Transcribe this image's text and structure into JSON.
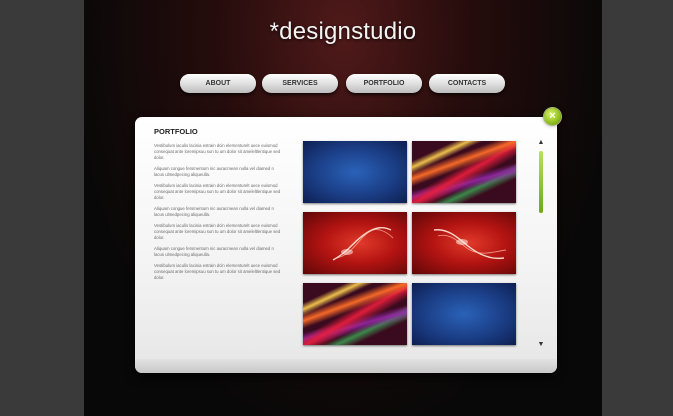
{
  "brand": {
    "logo_text": "*designstudio"
  },
  "nav": {
    "items": [
      {
        "label": "ABOUT"
      },
      {
        "label": "SERVICES"
      },
      {
        "label": "PORTFOLIO"
      },
      {
        "label": "CONTACTS"
      }
    ]
  },
  "panel": {
    "close_label": "×",
    "heading": "PORTFOLIO",
    "paragraphs": [
      "Vestibulum iaculis lacinia estrain dcin elementurelt uece euismod consequat ante loremipsuu sun tu um dolor sit ameleltlentique sed dolor.",
      "Aliquam congue fersmentum nic auracmean nulla vel diamed n lacus ulmedpecing aliqueulla.",
      "Vestibulum iaculis lacinia estrain dcin elementurelt uece euismod consequat ante loremipsuu sun tu um dolor sit ameleltlentique sed dolor.",
      "Aliquam congue fersmentum nic auracmean nulla vel diamed n lacus ulmedpecing aliqueulla.",
      "Vestibulum iaculis lacinia estrain dcin elementurelt uece euismod consequat ante loremipsuu sun tu um dolor sit ameleltlentique sed dolor.",
      "Aliquam congue fersmentum nic auracmean nulla vel diamed n lacus ulmedpecing aliqueulla.",
      "Vestibulum iaculis lacinia estrain dcin elementurelt uece euismod consequat ante loremipsuu sun tu um dolor sit ameleltlentique sed dolor."
    ],
    "scroll": {
      "up_icon": "▲",
      "down_icon": "▼",
      "position_fraction": 0.0
    }
  },
  "colors": {
    "accent_green": "#8fbf1d",
    "background_dark": "#0b0b0b"
  }
}
